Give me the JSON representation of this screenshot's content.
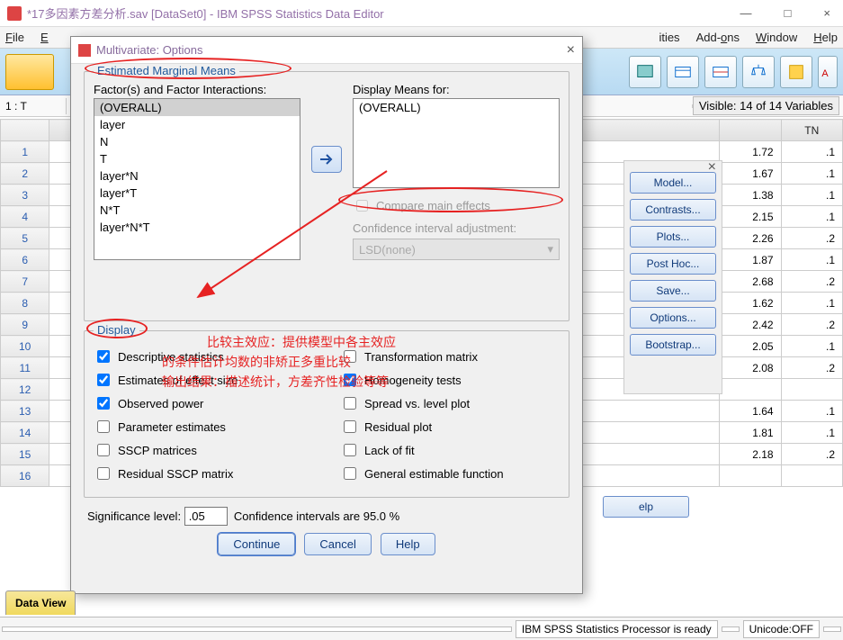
{
  "window": {
    "title": "*17多因素方差分析.sav [DataSet0] - IBM SPSS Statistics Data Editor",
    "min": "—",
    "max": "□",
    "close": "×"
  },
  "menubar": [
    "File",
    "E",
    "ities",
    "Add-ons",
    "Window",
    "Help"
  ],
  "inforow": {
    "label": "1 : T",
    "visible": "Visible: 14 of 14 Variables"
  },
  "columns": {
    "c1": "",
    "c2": "TN"
  },
  "rows": [
    {
      "n": "1",
      "v1": "1.72",
      "v2": ".1"
    },
    {
      "n": "2",
      "v1": "1.67",
      "v2": ".1"
    },
    {
      "n": "3",
      "v1": "1.38",
      "v2": ".1"
    },
    {
      "n": "4",
      "v1": "2.15",
      "v2": ".1"
    },
    {
      "n": "5",
      "v1": "2.26",
      "v2": ".2"
    },
    {
      "n": "6",
      "v1": "1.87",
      "v2": ".1"
    },
    {
      "n": "7",
      "v1": "2.68",
      "v2": ".2"
    },
    {
      "n": "8",
      "v1": "1.62",
      "v2": ".1"
    },
    {
      "n": "9",
      "v1": "2.42",
      "v2": ".2"
    },
    {
      "n": "10",
      "v1": "2.05",
      "v2": ".1"
    },
    {
      "n": "11",
      "v1": "2.08",
      "v2": ".2"
    },
    {
      "n": "12",
      "v1": "",
      "v2": ""
    },
    {
      "n": "13",
      "v1": "1.64",
      "v2": ".1"
    },
    {
      "n": "14",
      "v1": "1.81",
      "v2": ".1"
    },
    {
      "n": "15",
      "v1": "2.18",
      "v2": ".2"
    },
    {
      "n": "16",
      "v1": "",
      "v2": ""
    }
  ],
  "sidebuttons": {
    "close": "×",
    "model": "Model...",
    "contrasts": "Contrasts...",
    "plots": "Plots...",
    "posthoc": "Post Hoc...",
    "save": "Save...",
    "options": "Options...",
    "bootstrap": "Bootstrap...",
    "help": "elp"
  },
  "tabs": {
    "data": "Data View"
  },
  "status": {
    "ready": "IBM SPSS Statistics Processor is ready",
    "unicode": "Unicode:OFF"
  },
  "dialog": {
    "title": "Multivariate: Options",
    "close": "×",
    "group1_legend": "Estimated Marginal Means",
    "factors_label": "Factor(s) and Factor Interactions:",
    "factors": [
      "(OVERALL)",
      "layer",
      "N",
      "T",
      "layer*N",
      "layer*T",
      "N*T",
      "layer*N*T"
    ],
    "display_means_label": "Display Means for:",
    "display_means": [
      "(OVERALL)"
    ],
    "compare": "Compare main effects",
    "ci_adjust": "Confidence interval adjustment:",
    "ci_dropdown": "LSD(none)",
    "display_legend": "Display",
    "opts_left": [
      {
        "label": "Descriptive statistics",
        "checked": true
      },
      {
        "label": "Estimates of effect size",
        "checked": true
      },
      {
        "label": "Observed power",
        "checked": true
      },
      {
        "label": "Parameter estimates",
        "checked": false
      },
      {
        "label": "SSCP matrices",
        "checked": false
      },
      {
        "label": "Residual SSCP matrix",
        "checked": false
      }
    ],
    "opts_right": [
      {
        "label": "Transformation matrix",
        "checked": false
      },
      {
        "label": "Homogeneity tests",
        "checked": true
      },
      {
        "label": "Spread vs. level plot",
        "checked": false
      },
      {
        "label": "Residual plot",
        "checked": false
      },
      {
        "label": "Lack of fit",
        "checked": false
      },
      {
        "label": "General estimable function",
        "checked": false
      }
    ],
    "sig_label": "Significance level:",
    "sig_value": ".05",
    "ci_text": "Confidence intervals are 95.0 %",
    "buttons": {
      "continue": "Continue",
      "cancel": "Cancel",
      "help": "Help"
    }
  },
  "annotations": {
    "line1": "比较主效应：提供模型中各主效应",
    "line2": "的条件估计均数的非矫正多重比较",
    "line3": "输出结果：描述统计，方差齐性检验等等"
  }
}
